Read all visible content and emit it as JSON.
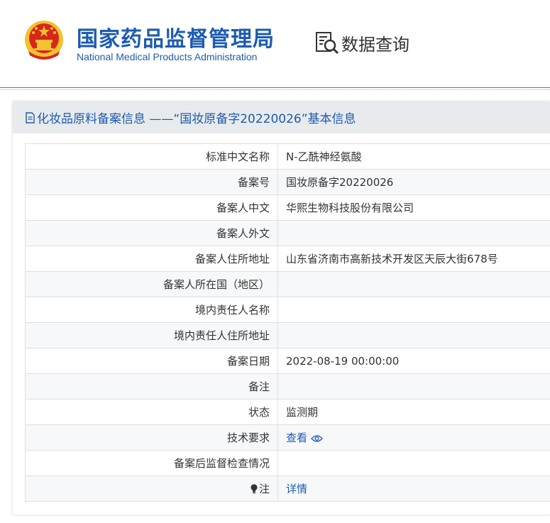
{
  "header": {
    "org_name_cn": "国家药品监督管理局",
    "org_name_en": "National Medical Products Administration",
    "section_title": "数据查询",
    "emblem_icon": "national-emblem-icon",
    "section_icon": "document-search-icon"
  },
  "panel": {
    "title": "化妆品原料备案信息 ——“国妆原备字20220026”基本信息",
    "title_icon": "document-icon"
  },
  "rows": [
    {
      "label": "标准中文名称",
      "value": "N-乙酰神经氨酸"
    },
    {
      "label": "备案号",
      "value": "国妆原备字20220026"
    },
    {
      "label": "备案人中文",
      "value": "华熙生物科技股份有限公司"
    },
    {
      "label": "备案人外文",
      "value": ""
    },
    {
      "label": "备案人住所地址",
      "value": "山东省济南市高新技术开发区天辰大街678号"
    },
    {
      "label": "备案人所在国（地区）",
      "value": ""
    },
    {
      "label": "境内责任人名称",
      "value": ""
    },
    {
      "label": "境内责任人住所地址",
      "value": ""
    },
    {
      "label": "备案日期",
      "value": "2022-08-19 00:00:00"
    },
    {
      "label": "备注",
      "value": ""
    },
    {
      "label": "状态",
      "value": "监测期"
    },
    {
      "label": "技术要求",
      "value": "查看",
      "icon": "eye-icon"
    },
    {
      "label": "备案后监督检查情况",
      "value": ""
    },
    {
      "label": "注",
      "value": "详情",
      "icon": "lightbulb-icon"
    }
  ],
  "colors": {
    "brand_blue": "#1d5bb0",
    "panel_header_bg": "#e8ebee",
    "emblem_red": "#d8261c",
    "emblem_gold": "#f2c230"
  }
}
